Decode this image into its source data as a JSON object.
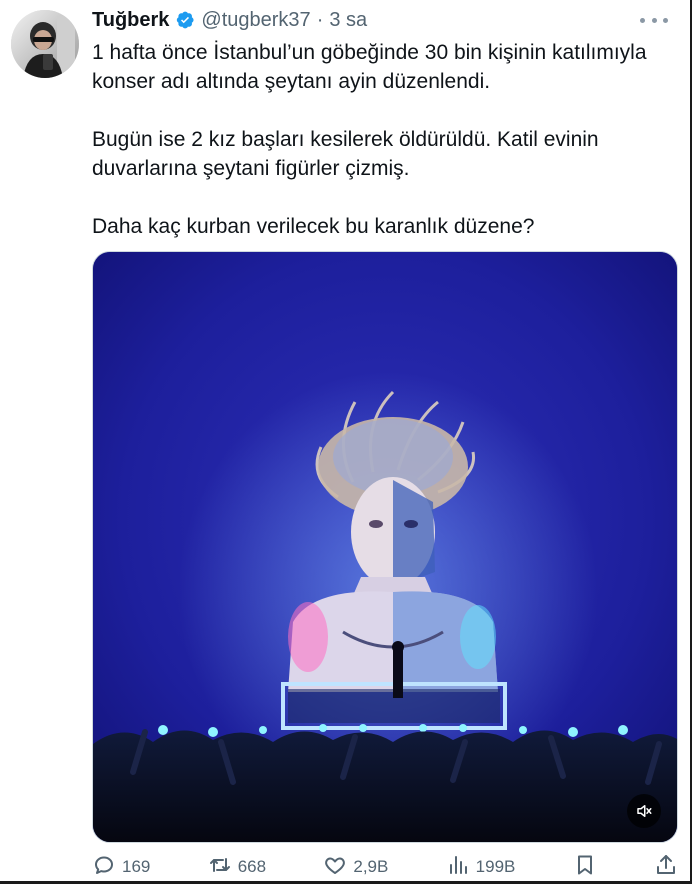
{
  "author": {
    "display_name": "Tuğberk",
    "handle": "@tugberk37",
    "separator": "·",
    "time": "3 sa",
    "verified": true
  },
  "tweet": {
    "paragraphs": [
      "1 hafta önce İstanbul’un göbeğinde 30 bin kişinin katılımıyla konser adı altında şeytanı ayin düzenlendi.",
      "Bugün ise 2 kız başları kesilerek öldürüldü. Katil evinin duvarlarına şeytani figürler çizmiş.",
      "Daha kaç kurban verilecek bu karanlık düzene?"
    ]
  },
  "media": {
    "type": "video",
    "muted": true
  },
  "actions": {
    "replies": "169",
    "reposts": "668",
    "likes": "2,9B",
    "views": "199B"
  },
  "colors": {
    "text": "#0f1419",
    "muted": "#536471",
    "verified": "#1d9bf0",
    "media_bg": "#1a1a9e"
  },
  "icons": [
    "verified-badge-icon",
    "more-icon",
    "mute-icon",
    "reply-icon",
    "repost-icon",
    "like-icon",
    "views-icon",
    "bookmark-icon",
    "share-icon"
  ]
}
